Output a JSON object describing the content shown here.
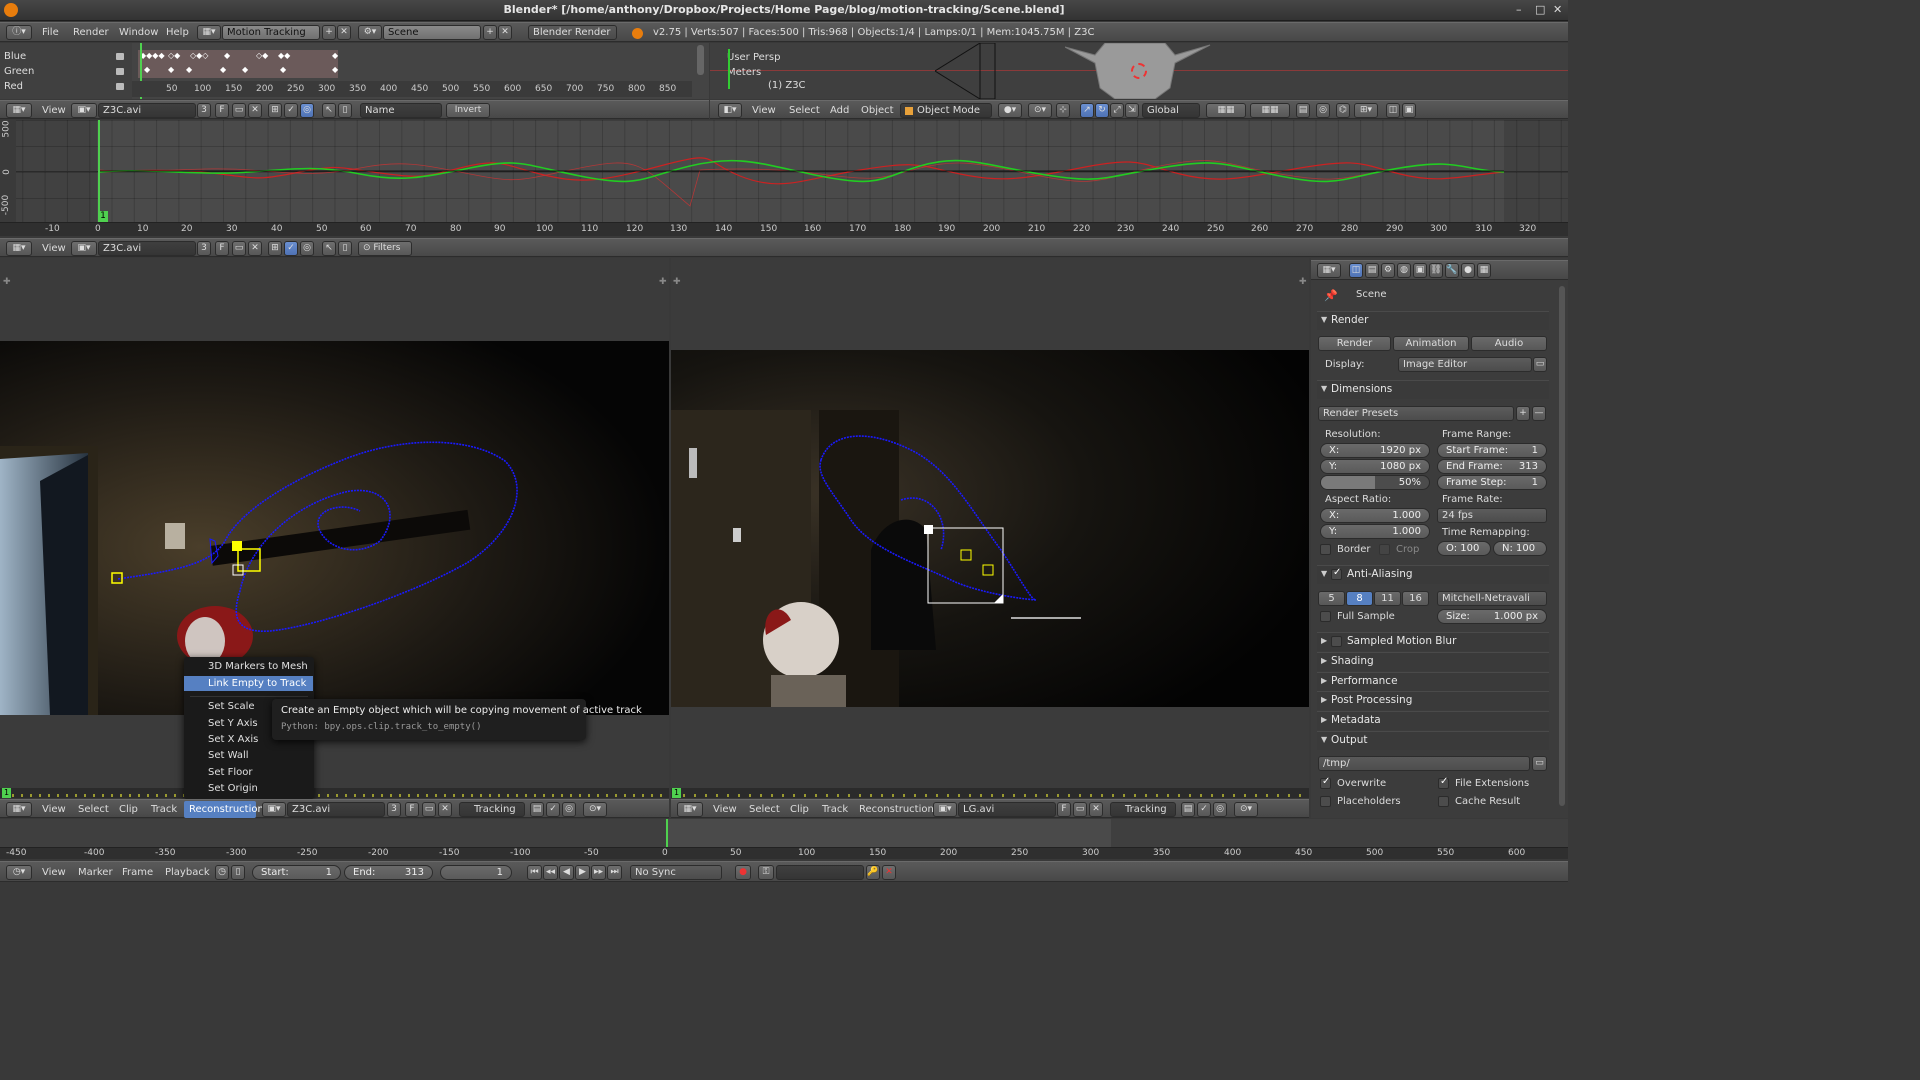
{
  "title": "Blender* [/home/anthony/Dropbox/Projects/Home Page/blog/motion-tracking/Scene.blend]",
  "top_menu": [
    "File",
    "Render",
    "Window",
    "Help"
  ],
  "screen_layout": "Motion Tracking",
  "scene": "Scene",
  "engine": "Blender Render",
  "stats": "v2.75 | Verts:507 | Faces:500 | Tris:968 | Objects:1/4 | Lamps:0/1 | Mem:1045.75M | Z3C",
  "dopesheet": {
    "channels": [
      "Blue",
      "Green",
      "Red"
    ],
    "ticks": [
      "50",
      "100",
      "150",
      "200",
      "250",
      "300",
      "350",
      "400",
      "450",
      "500",
      "550",
      "600",
      "650",
      "700",
      "750",
      "800",
      "850"
    ],
    "header": {
      "view": "View",
      "clip": "Z3C.avi",
      "users": "3",
      "f": "F",
      "sort": "Name",
      "invert": "Invert"
    }
  },
  "viewport3d": {
    "persp": "User Persp",
    "units": "Meters",
    "object": "(1) Z3C",
    "header": {
      "view": "View",
      "select": "Select",
      "add": "Add",
      "object": "Object",
      "mode": "Object Mode",
      "orient": "Global"
    }
  },
  "graph": {
    "y_ticks": [
      "500",
      "0",
      "-500"
    ],
    "frame": "1",
    "x_ticks": [
      "-10",
      "0",
      "10",
      "20",
      "30",
      "40",
      "50",
      "60",
      "70",
      "80",
      "90",
      "100",
      "110",
      "120",
      "130",
      "140",
      "150",
      "160",
      "170",
      "180",
      "190",
      "200",
      "210",
      "220",
      "230",
      "240",
      "250",
      "260",
      "270",
      "280",
      "290",
      "300",
      "310",
      "320"
    ],
    "header": {
      "view": "View",
      "clip": "Z3C.avi",
      "users": "3",
      "f": "F",
      "filters": "Filters"
    }
  },
  "clip_left": {
    "frame": "1",
    "menu": [
      "3D Markers to Mesh",
      "Link Empty to Track",
      "Set Scale",
      "Set Y Axis",
      "Set X Axis",
      "Set Wall",
      "Set Floor",
      "Set Origin"
    ],
    "tooltip": {
      "text": "Create an Empty object which will be copying movement of active track",
      "python": "Python: bpy.ops.clip.track_to_empty()"
    },
    "header": {
      "view": "View",
      "select": "Select",
      "clip": "Clip",
      "track": "Track",
      "reconstruction": "Reconstruction",
      "file": "Z3C.avi",
      "users": "3",
      "f": "F",
      "mode": "Tracking"
    }
  },
  "clip_right": {
    "frame": "1",
    "header": {
      "view": "View",
      "select": "Select",
      "clip": "Clip",
      "track": "Track",
      "reconstruction": "Reconstruction",
      "file": "LG.avi",
      "f": "F",
      "mode": "Tracking"
    }
  },
  "properties": {
    "context": "Scene",
    "render": {
      "title": "Render",
      "render": "Render",
      "animation": "Animation",
      "audio": "Audio",
      "display_label": "Display:",
      "display": "Image Editor"
    },
    "dimensions": {
      "title": "Dimensions",
      "presets": "Render Presets",
      "resolution": "Resolution:",
      "res_x": "1920 px",
      "res_y": "1080 px",
      "percent": "50%",
      "percent_value": 0.5,
      "frame_range": "Frame Range:",
      "start_label": "Start Frame:",
      "start": "1",
      "end_label": "End Frame:",
      "end": "313",
      "step_label": "Frame Step:",
      "step": "1",
      "aspect": "Aspect Ratio:",
      "asp_x": "1.000",
      "asp_y": "1.000",
      "frame_rate": "Frame Rate:",
      "fps": "24 fps",
      "border": "Border",
      "crop": "Crop",
      "remap": "Time Remapping:",
      "old": "O: 100",
      "new": "N: 100",
      "x": "X:",
      "y": "Y:"
    },
    "aa": {
      "title": "Anti-Aliasing",
      "samples": [
        "5",
        "8",
        "11",
        "16"
      ],
      "selected": "8",
      "filter": "Mitchell-Netravali",
      "full_sample": "Full Sample",
      "size_label": "Size:",
      "size": "1.000 px"
    },
    "collapsed": [
      "Sampled Motion Blur",
      "Shading",
      "Performance",
      "Post Processing",
      "Metadata"
    ],
    "output": {
      "title": "Output",
      "path": "/tmp/",
      "overwrite": "Overwrite",
      "file_ext": "File Extensions",
      "placeholders": "Placeholders",
      "cache": "Cache Result"
    }
  },
  "timeline": {
    "ticks": [
      "-450",
      "-400",
      "-350",
      "-300",
      "-250",
      "-200",
      "-150",
      "-100",
      "-50",
      "0",
      "50",
      "100",
      "150",
      "200",
      "250",
      "300",
      "350",
      "400",
      "450",
      "500",
      "550",
      "600"
    ],
    "menus": [
      "View",
      "Marker",
      "Frame",
      "Playback"
    ],
    "start_label": "Start:",
    "start": "1",
    "end_label": "End:",
    "end": "313",
    "current": "1",
    "sync": "No Sync"
  },
  "colors": {
    "accent": "#5680c2",
    "track_path": "#1a1aff",
    "marker": "#ffff00",
    "active_menu": "#5680c2"
  }
}
